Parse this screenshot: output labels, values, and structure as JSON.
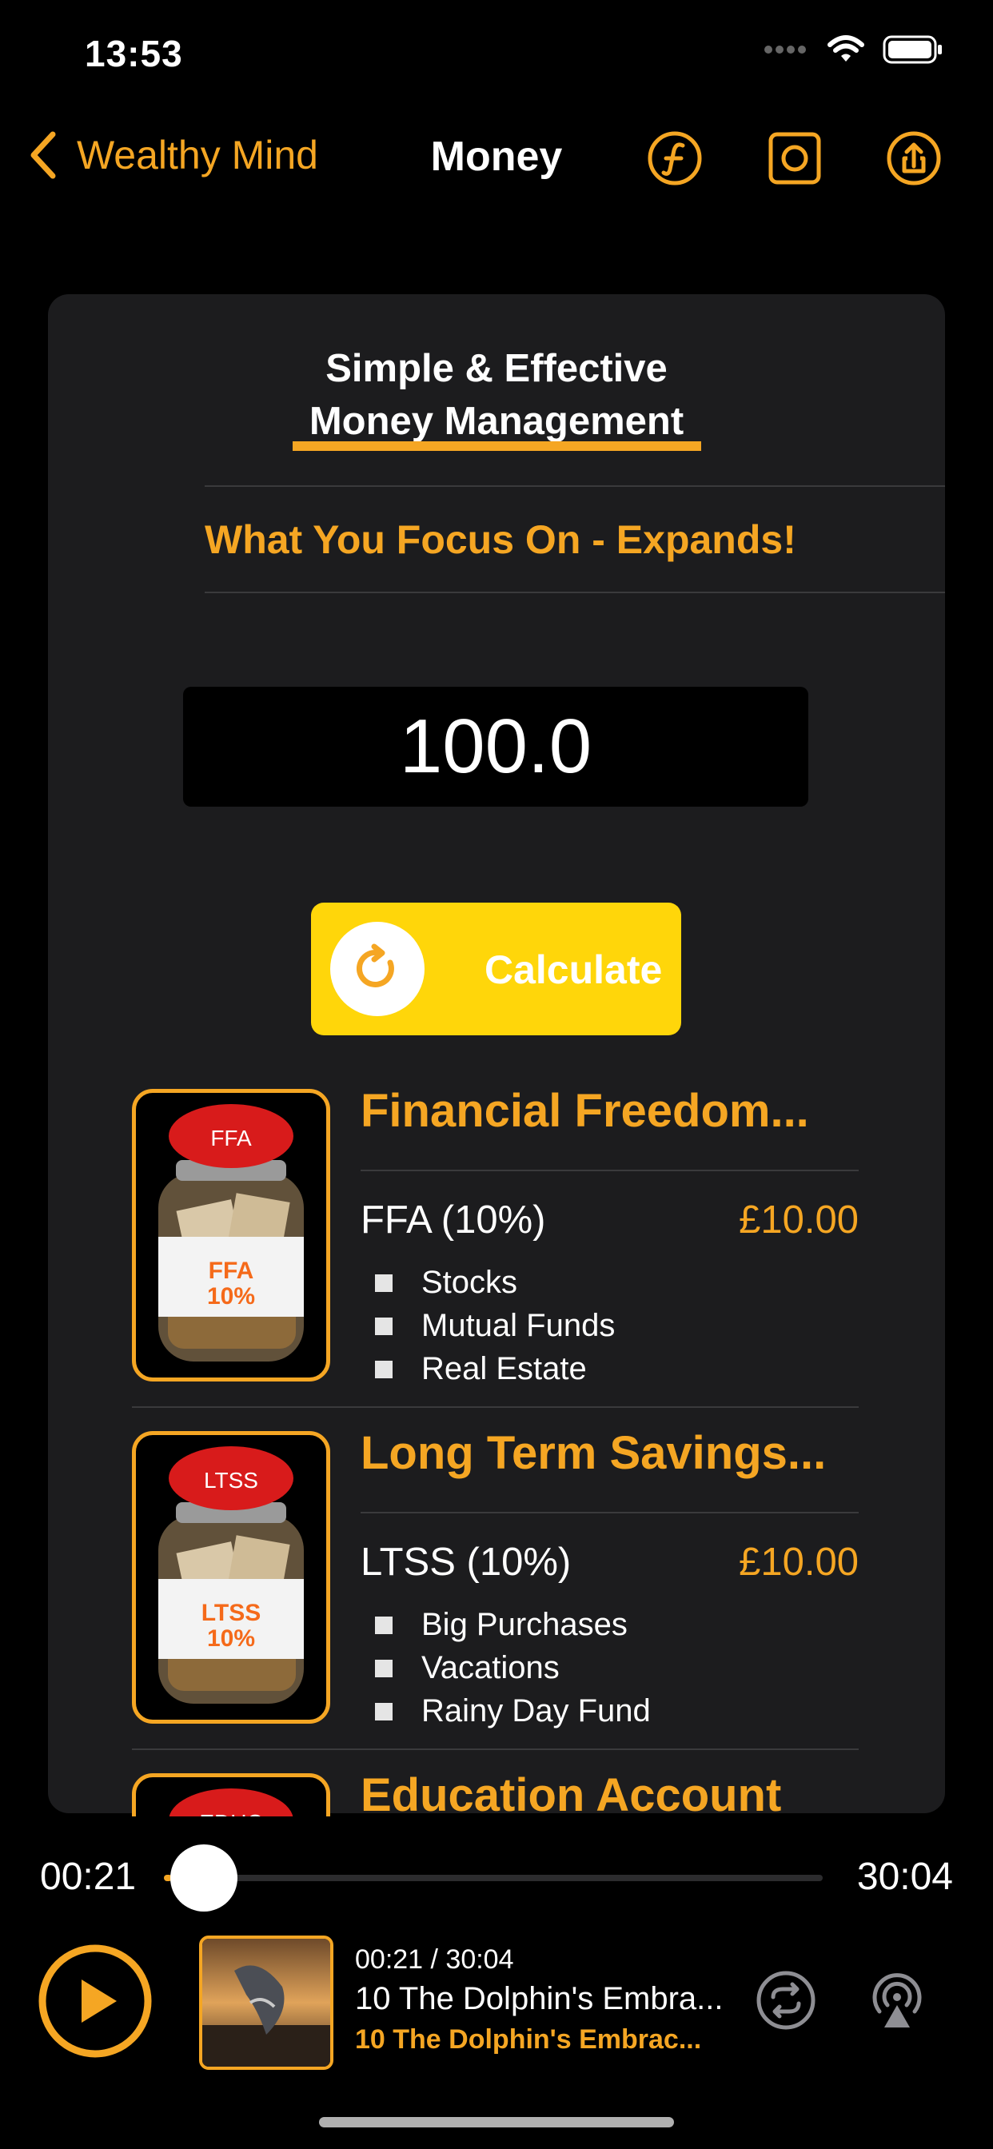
{
  "status_bar": {
    "time": "13:53"
  },
  "nav": {
    "back_label": "Wealthy Mind",
    "title": "Money"
  },
  "card": {
    "heading_line1": "Simple & Effective",
    "heading_line2": "Money Management",
    "focus_text": "What You Focus On - Expands!",
    "amount": "100.0",
    "calculate_label": "Calculate"
  },
  "accounts": [
    {
      "title": "Financial Freedom...",
      "jar_label": "FFA",
      "jar_pct": "10%",
      "name": "FFA (10%)",
      "value": "£10.00",
      "bullets": [
        "Stocks",
        "Mutual Funds",
        "Real Estate"
      ]
    },
    {
      "title": "Long Term Savings...",
      "jar_label": "LTSS",
      "jar_pct": "10%",
      "name": "LTSS (10%)",
      "value": "£10.00",
      "bullets": [
        "Big Purchases",
        "Vacations",
        "Rainy Day Fund"
      ]
    },
    {
      "title": "Education Account",
      "jar_label": "EDUC"
    }
  ],
  "player": {
    "elapsed": "00:21",
    "duration": "30:04",
    "progress": 0.0116,
    "np_time": "00:21 /  30:04",
    "np_title": "10 The Dolphin's Embra...",
    "np_subtitle": "10 The Dolphin's Embrac..."
  },
  "colors": {
    "accent": "#F5A623",
    "button": "#FFD60A",
    "card": "#1c1c1e",
    "jar_lid": "#d81b1b"
  },
  "icons": [
    "chevron-left-icon",
    "florin-icon",
    "camera-icon",
    "share-icon",
    "refresh-icon",
    "play-icon",
    "repeat-icon",
    "airplay-icon",
    "wifi-icon",
    "battery-icon",
    "signal-icon"
  ]
}
